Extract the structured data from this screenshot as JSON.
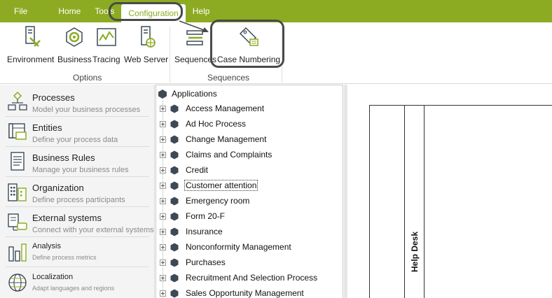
{
  "menu": {
    "items": [
      "File",
      "Home",
      "Tools",
      "Configuration",
      "Help"
    ],
    "active": "Configuration"
  },
  "ribbon": {
    "options_group": {
      "label": "Options",
      "buttons": [
        "Environment",
        "Business",
        "Tracing",
        "Web Server"
      ]
    },
    "sequences_group": {
      "label": "Sequences",
      "buttons": [
        "Sequences",
        "Case Numbering"
      ]
    }
  },
  "nav": {
    "items": [
      {
        "title": "Processes",
        "subtitle": "Model your business processes",
        "icon": "process-flow-icon"
      },
      {
        "title": "Entities",
        "subtitle": "Define your process data",
        "icon": "entity-table-icon"
      },
      {
        "title": "Business Rules",
        "subtitle": "Manage your business rules",
        "icon": "rules-document-icon"
      },
      {
        "title": "Organization",
        "subtitle": "Define process participants",
        "icon": "organization-building-icon"
      },
      {
        "title": "External systems",
        "subtitle": "Connect with your external systems",
        "icon": "external-systems-icon"
      },
      {
        "title": "Analysis",
        "subtitle": "Define process metrics",
        "icon": "analysis-bars-icon"
      },
      {
        "title": "Localization",
        "subtitle": "Adapt languages and regions",
        "icon": "globe-icon"
      }
    ]
  },
  "tree": {
    "root": "Applications",
    "items": [
      "Access Management",
      "Ad Hoc Process",
      "Change Management",
      "Claims and Complaints",
      "Credit",
      "Customer attention",
      "Emergency room",
      "Form 20-F",
      "Insurance",
      "Nonconformity Management",
      "Purchases",
      "Recruitment And Selection Process",
      "Sales Opportunity Management"
    ],
    "selected": "Customer attention"
  },
  "canvas": {
    "lane_label": "Help Desk"
  },
  "colors": {
    "accent": "#8cab22",
    "icon_dark": "#3d4a55",
    "icon_green": "#8cab22"
  }
}
